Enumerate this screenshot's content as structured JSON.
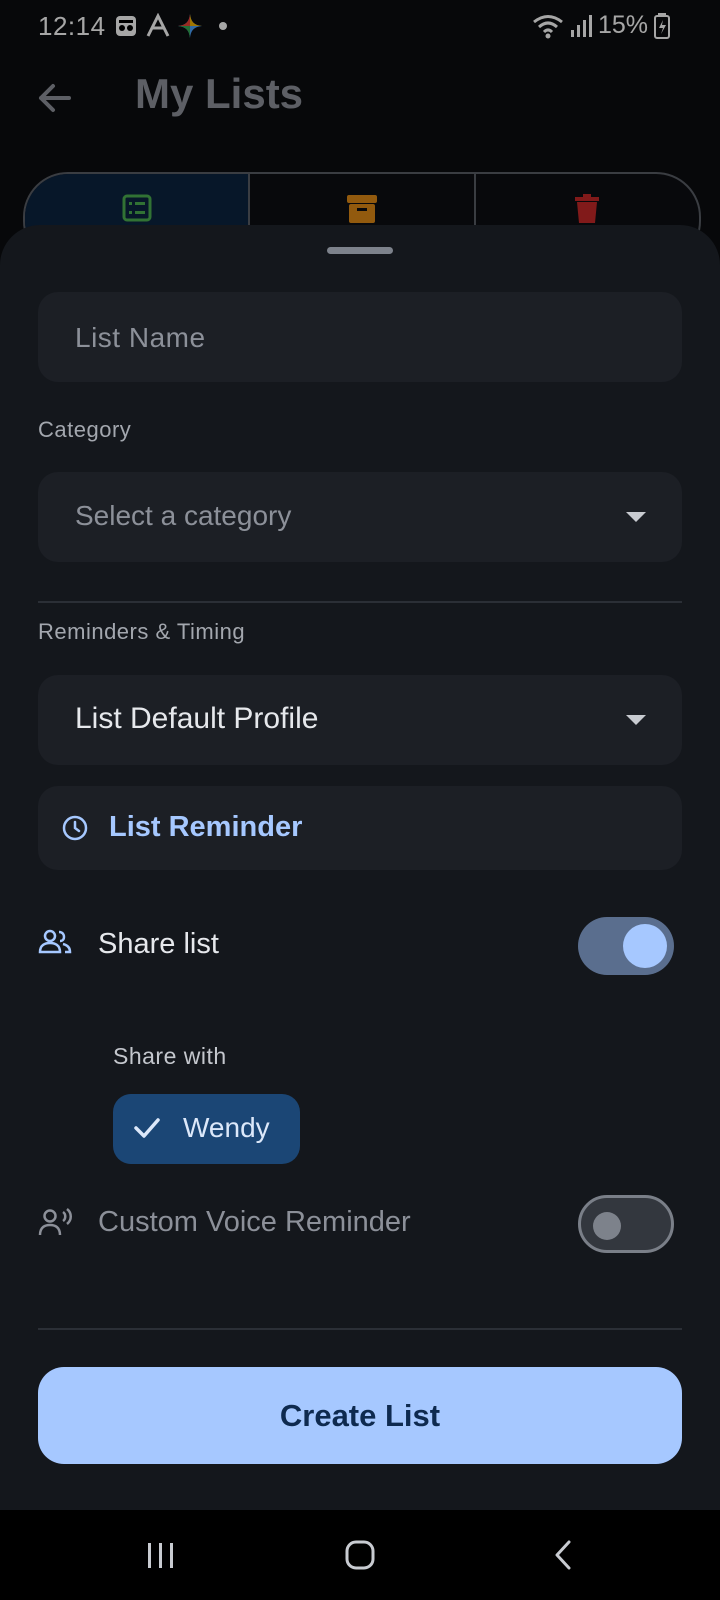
{
  "status_bar": {
    "time": "12:14",
    "battery": "15%"
  },
  "app_bar": {
    "title": "My Lists"
  },
  "segments": [
    {
      "icon": "list-icon",
      "color": "#4caf50"
    },
    {
      "icon": "archive-icon",
      "color": "#e08a16"
    },
    {
      "icon": "trash-icon",
      "color": "#c62828"
    }
  ],
  "sheet": {
    "list_name_placeholder": "List Name",
    "category_label": "Category",
    "category_placeholder": "Select a category",
    "reminders_label": "Reminders & Timing",
    "profile_value": "List Default Profile",
    "reminder_button": "List Reminder",
    "share_list_label": "Share list",
    "share_list_enabled": true,
    "share_with_label": "Share with",
    "share_chip": "Wendy",
    "voice_label": "Custom Voice Reminder",
    "voice_enabled": false,
    "create_button": "Create List"
  },
  "colors": {
    "accent": "#a6c8ff",
    "sheet": "#14171c",
    "chip": "#1b4675"
  }
}
